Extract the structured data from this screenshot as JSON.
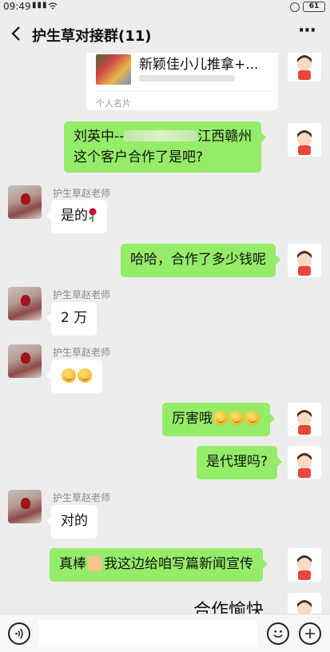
{
  "status_bar": {
    "time": "09:49",
    "signal": "4G",
    "battery": "61"
  },
  "header": {
    "title": "护生草对接群(11)",
    "more": "···"
  },
  "messages": {
    "card": {
      "name": "新颖佳小儿推拿+...",
      "kind": "个人名片"
    },
    "m1": {
      "line1_a": "刘英中--",
      "line1_b": "江西赣州",
      "line2": "这个客户合作了是吧?"
    },
    "m2": {
      "sender": "护生草赵老师",
      "text": "是的"
    },
    "m3": {
      "text": "哈哈，合作了多少钱呢"
    },
    "m4": {
      "sender": "护生草赵老师",
      "text": "2 万"
    },
    "m5": {
      "sender": "护生草赵老师"
    },
    "m6": {
      "text": "厉害哦"
    },
    "m7": {
      "text": "是代理吗?"
    },
    "m8": {
      "sender": "护生草赵老师",
      "text": "对的"
    },
    "m9": {
      "text_a": "真棒",
      "text_b": "我这边给咱写篇新闻宣传"
    },
    "m10": {
      "text": "合作愉快"
    }
  },
  "icons": [
    "back-icon",
    "more-icon",
    "voice-icon",
    "emoji-icon",
    "plus-icon",
    "smile-emoji",
    "rose-emoji",
    "thumbs-up-emoji"
  ],
  "colors": {
    "background": "#ededed",
    "outgoing_bubble": "#95ec69",
    "incoming_bubble": "#ffffff",
    "sender_name": "#8a8a8a"
  }
}
